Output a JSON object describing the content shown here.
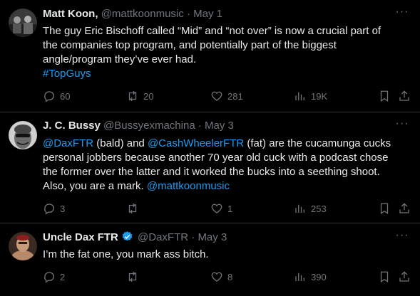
{
  "tweets": [
    {
      "name": "Matt Koon,",
      "handle": "@mattkoonmusic",
      "sep": "·",
      "date": "May 1",
      "lines": [
        "The guy Eric Bischoff called “Mid”  and “not over” is now a crucial part of",
        "the companies top program, and potentially part of the biggest",
        "angle/program they’ve ever had."
      ],
      "hashtag": "#TopGuys",
      "replies": "60",
      "retweets": "20",
      "likes": "281",
      "views": "19K"
    },
    {
      "name": "J. C. Bussy",
      "handle": "@Bussyexmachina",
      "sep": "·",
      "date": "May 3",
      "mention1": "@DaxFTR",
      "text1": " (bald) and ",
      "mention2": "@CashWheelerFTR",
      "text2": " (fat) are the cucamunga cucks",
      "lines": [
        "personal jobbers because another 70 year old cuck with a podcast chose",
        "the former over the latter and it worked the bucks into a seething shoot."
      ],
      "text3": "Also, you are a mark. ",
      "mention3": "@mattkoonmusic",
      "replies": "3",
      "retweets": "",
      "likes": "1",
      "views": "253"
    },
    {
      "name": "Uncle Dax FTR",
      "handle": "@DaxFTR",
      "sep": "·",
      "date": "May 3",
      "text": "I’m the fat one, you mark ass bitch.",
      "replies": "2",
      "retweets": "",
      "likes": "8",
      "views": "390"
    }
  ],
  "more_glyph": "···",
  "colors": {
    "link": "#1d9bf0",
    "muted": "#71767b",
    "text": "#e7e9ea",
    "verified": "#1d9bf0"
  }
}
